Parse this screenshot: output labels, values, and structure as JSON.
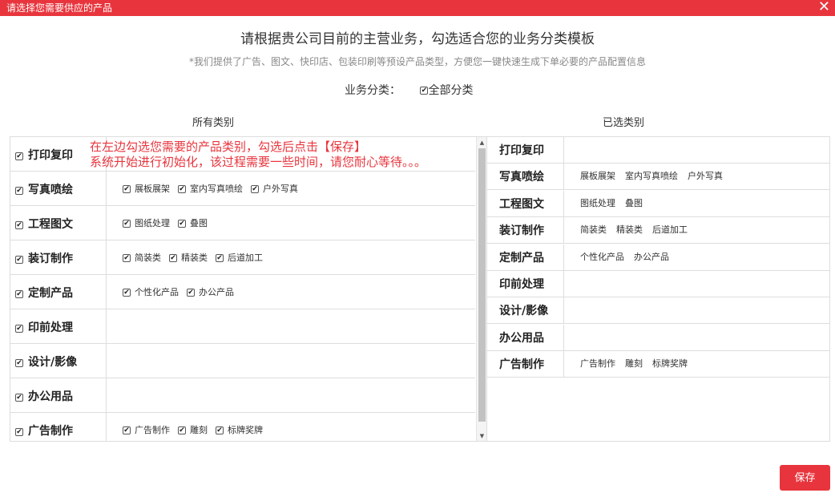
{
  "dialog": {
    "title": "请选择您需要供应的产品",
    "close_label": "✕",
    "heading": "请根据贵公司目前的主营业务，勾选适合您的业务分类模板",
    "subheading": "*我们提供了广告、图文、快印店、包装印刷等预设产品类型，方便您一键快速生成下单必要的产品配置信息",
    "business_label": "业务分类：",
    "all_label": "全部分类",
    "left_header": "所有类别",
    "right_header": "已选类别",
    "hint_line1": "在左边勾选您需要的产品类别，勾选后点击【保存】",
    "hint_line2": "系统开始进行初始化，该过程需要一些时间，请您耐心等待。。。",
    "save_label": "保存"
  },
  "left_categories": [
    {
      "name": "打印复印",
      "subs": []
    },
    {
      "name": "写真喷绘",
      "subs": [
        "展板展架",
        "室内写真喷绘",
        "户外写真"
      ]
    },
    {
      "name": "工程图文",
      "subs": [
        "图纸处理",
        "叠图"
      ]
    },
    {
      "name": "装订制作",
      "subs": [
        "简装类",
        "精装类",
        "后道加工"
      ]
    },
    {
      "name": "定制产品",
      "subs": [
        "个性化产品",
        "办公产品"
      ]
    },
    {
      "name": "印前处理",
      "subs": []
    },
    {
      "name": "设计/影像",
      "subs": []
    },
    {
      "name": "办公用品",
      "subs": []
    },
    {
      "name": "广告制作",
      "subs": [
        "广告制作",
        "雕刻",
        "标牌奖牌"
      ]
    }
  ],
  "right_categories": [
    {
      "name": "打印复印",
      "subs": []
    },
    {
      "name": "写真喷绘",
      "subs": [
        "展板展架",
        "室内写真喷绘",
        "户外写真"
      ]
    },
    {
      "name": "工程图文",
      "subs": [
        "图纸处理",
        "叠图"
      ]
    },
    {
      "name": "装订制作",
      "subs": [
        "简装类",
        "精装类",
        "后道加工"
      ]
    },
    {
      "name": "定制产品",
      "subs": [
        "个性化产品",
        "办公产品"
      ]
    },
    {
      "name": "印前处理",
      "subs": []
    },
    {
      "name": "设计/影像",
      "subs": []
    },
    {
      "name": "办公用品",
      "subs": []
    },
    {
      "name": "广告制作",
      "subs": [
        "广告制作",
        "雕刻",
        "标牌奖牌"
      ]
    }
  ],
  "colors": {
    "accent": "#e8353d"
  }
}
